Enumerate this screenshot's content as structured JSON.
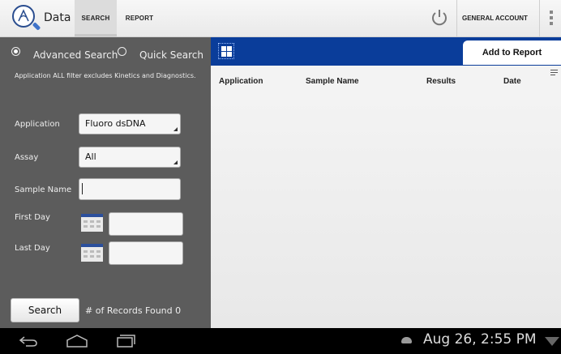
{
  "header": {
    "app_title": "Data",
    "tabs": [
      "SEARCH",
      "REPORT"
    ],
    "account_label": "GENERAL ACCOUNT",
    "icons": [
      "app-logo-icon",
      "power-icon",
      "overflow-menu-icon"
    ]
  },
  "search_panel": {
    "mode_advanced": "Advanced Search",
    "mode_quick": "Quick Search",
    "selected_mode": "Advanced Search",
    "note": "Application ALL filter excludes Kinetics and Diagnostics.",
    "application_label": "Application",
    "application_value": "Fluoro dsDNA",
    "assay_label": "Assay",
    "assay_value": "All",
    "sample_name_label": "Sample Name",
    "sample_name_value": "",
    "first_day_label": "First Day",
    "first_day_value": "",
    "last_day_label": "Last Day",
    "last_day_value": "",
    "search_button": "Search",
    "records_label": "# of Records Found",
    "records_count": "0"
  },
  "results": {
    "add_to_report": "Add to Report",
    "columns": [
      "Application",
      "Sample Name",
      "Results",
      "Date"
    ],
    "rows": []
  },
  "system_bar": {
    "clock": "Aug 26, 2:55 PM"
  },
  "colors": {
    "accent_blue": "#0a3d9a",
    "panel_gray": "#5c5c5c"
  }
}
